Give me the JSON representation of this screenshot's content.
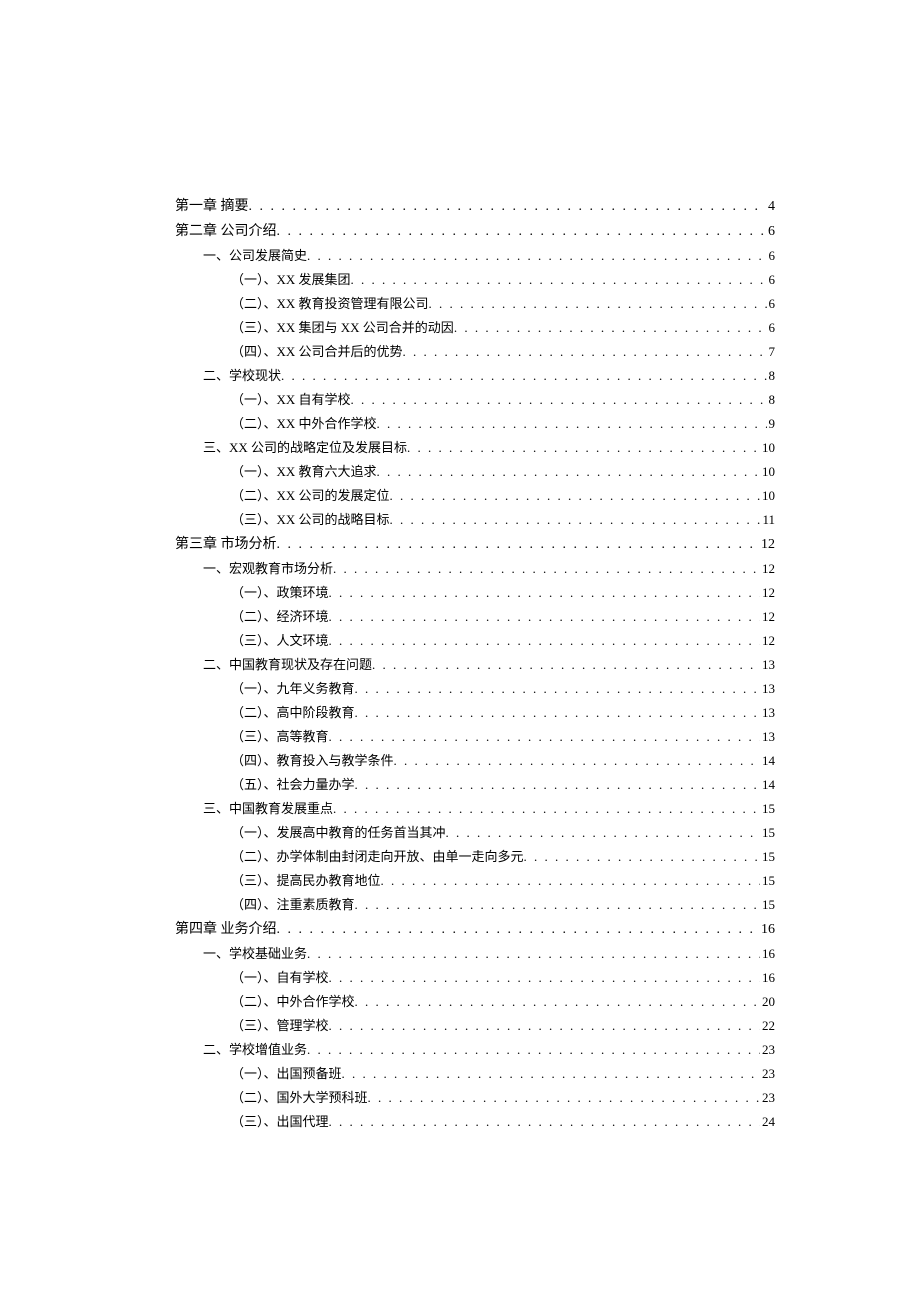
{
  "toc": [
    {
      "level": 1,
      "title": "第一章 摘要",
      "page": "4"
    },
    {
      "level": 1,
      "title": "第二章 公司介绍",
      "page": "6"
    },
    {
      "level": 2,
      "title": "一、公司发展简史",
      "page": "6"
    },
    {
      "level": 3,
      "title": "（一）、XX 发展集团",
      "page": "6"
    },
    {
      "level": 3,
      "title": "（二）、XX 教育投资管理有限公司",
      "page": "6"
    },
    {
      "level": 3,
      "title": "（三）、XX 集团与 XX 公司合并的动因",
      "page": "6"
    },
    {
      "level": 3,
      "title": "（四）、XX 公司合并后的优势",
      "page": "7"
    },
    {
      "level": 2,
      "title": "二、学校现状",
      "page": "8"
    },
    {
      "level": 3,
      "title": "（一）、XX 自有学校",
      "page": "8"
    },
    {
      "level": 3,
      "title": "（二）、XX 中外合作学校",
      "page": "9"
    },
    {
      "level": 2,
      "title": "三、XX 公司的战略定位及发展目标",
      "page": "10"
    },
    {
      "level": 3,
      "title": "（一）、XX 教育六大追求",
      "page": "10"
    },
    {
      "level": 3,
      "title": "（二）、XX 公司的发展定位",
      "page": "10"
    },
    {
      "level": 3,
      "title": "（三）、XX 公司的战略目标",
      "page": "11"
    },
    {
      "level": 1,
      "title": "第三章 市场分析",
      "page": "12"
    },
    {
      "level": 2,
      "title": "一、宏观教育市场分析",
      "page": "12"
    },
    {
      "level": 3,
      "title": "（一）、政策环境",
      "page": "12"
    },
    {
      "level": 3,
      "title": "（二）、经济环境",
      "page": "12"
    },
    {
      "level": 3,
      "title": "（三）、人文环境",
      "page": "12"
    },
    {
      "level": 2,
      "title": "二、中国教育现状及存在问题",
      "page": "13"
    },
    {
      "level": 3,
      "title": "（一）、九年义务教育",
      "page": "13"
    },
    {
      "level": 3,
      "title": "（二）、高中阶段教育",
      "page": "13"
    },
    {
      "level": 3,
      "title": "（三）、高等教育",
      "page": "13"
    },
    {
      "level": 3,
      "title": "（四）、教育投入与教学条件",
      "page": "14"
    },
    {
      "level": 3,
      "title": "（五）、社会力量办学",
      "page": "14"
    },
    {
      "level": 2,
      "title": "三、中国教育发展重点",
      "page": "15"
    },
    {
      "level": 3,
      "title": "（一）、发展高中教育的任务首当其冲",
      "page": "15"
    },
    {
      "level": 3,
      "title": "（二）、办学体制由封闭走向开放、由单一走向多元",
      "page": "15"
    },
    {
      "level": 3,
      "title": "（三）、提高民办教育地位",
      "page": "15"
    },
    {
      "level": 3,
      "title": "（四）、注重素质教育",
      "page": "15"
    },
    {
      "level": 1,
      "title": "第四章 业务介绍",
      "page": "16"
    },
    {
      "level": 2,
      "title": "一、学校基础业务",
      "page": "16"
    },
    {
      "level": 3,
      "title": "（一）、自有学校",
      "page": "16"
    },
    {
      "level": 3,
      "title": "（二）、中外合作学校",
      "page": "20"
    },
    {
      "level": 3,
      "title": "（三）、管理学校",
      "page": "22"
    },
    {
      "level": 2,
      "title": "二、学校增值业务",
      "page": "23"
    },
    {
      "level": 3,
      "title": "（一）、出国预备班",
      "page": "23"
    },
    {
      "level": 3,
      "title": "（二）、国外大学预科班",
      "page": "23"
    },
    {
      "level": 3,
      "title": "（三）、出国代理",
      "page": "24"
    }
  ]
}
